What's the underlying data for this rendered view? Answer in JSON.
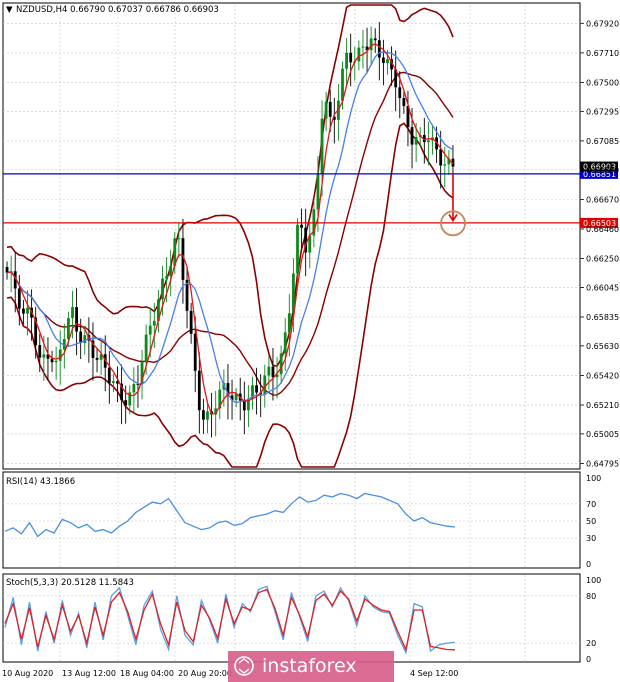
{
  "chart_data": [
    {
      "type": "candlestick",
      "title": "NZDUSD,H4  0.66790 0.67037 0.66786 0.66903",
      "symbol_marker": "▼",
      "ylim": [
        0.6477,
        0.6805
      ],
      "y_ticks": [
        0.6792,
        0.6771,
        0.675,
        0.67295,
        0.67085,
        0.6688,
        0.6667,
        0.6646,
        0.6625,
        0.66045,
        0.65835,
        0.6563,
        0.6542,
        0.6521,
        0.65005,
        0.64795
      ],
      "y_tick_labels": [
        "0.67920",
        "0.67710",
        "0.67500",
        "0.67295",
        "0.67085",
        "0.66880",
        "0.66670",
        "0.66460",
        "0.66250",
        "0.66045",
        "0.65835",
        "0.65630",
        "0.65420",
        "0.65210",
        "0.65005",
        "0.64795"
      ],
      "price_levels": [
        {
          "value": 0.66851,
          "label": "0.66851",
          "color": "#0000cc"
        },
        {
          "value": 0.66503,
          "label": "0.66503",
          "color": "#e00000"
        }
      ],
      "current_price": {
        "value": 0.66903,
        "label": "0.66903"
      },
      "close_path": [
        0.6615,
        0.6602,
        0.6581,
        0.659,
        0.6553,
        0.656,
        0.6542,
        0.657,
        0.6589,
        0.6573,
        0.6565,
        0.6552,
        0.6546,
        0.654,
        0.6531,
        0.6525,
        0.6533,
        0.656,
        0.6585,
        0.6606,
        0.6621,
        0.664,
        0.6598,
        0.6554,
        0.6515,
        0.6512,
        0.6525,
        0.653,
        0.6528,
        0.6524,
        0.653,
        0.6527,
        0.654,
        0.6545,
        0.656,
        0.66,
        0.665,
        0.6628,
        0.666,
        0.6745,
        0.672,
        0.674,
        0.677,
        0.6765,
        0.6782,
        0.678,
        0.6768,
        0.6758,
        0.6752,
        0.673,
        0.6712,
        0.6705,
        0.671,
        0.67,
        0.6697,
        0.669
      ],
      "annotations": [
        {
          "type": "arrow",
          "from": 0.6685,
          "to": 0.6652,
          "color": "#e00000"
        },
        {
          "type": "circle",
          "at": 0.665,
          "color": "#c8845a"
        }
      ]
    },
    {
      "type": "line",
      "title": "RSI(14) 43.1866",
      "ylim": [
        0,
        100
      ],
      "y_ticks": [
        100,
        70,
        50,
        30,
        0
      ],
      "y_tick_labels": [
        "100",
        "70",
        "50",
        "30",
        "0"
      ],
      "values": [
        38,
        42,
        35,
        48,
        32,
        40,
        36,
        52,
        48,
        42,
        46,
        38,
        40,
        36,
        44,
        50,
        60,
        66,
        72,
        70,
        76,
        62,
        48,
        44,
        40,
        42,
        48,
        50,
        45,
        47,
        54,
        56,
        58,
        62,
        60,
        70,
        78,
        72,
        74,
        80,
        78,
        82,
        80,
        76,
        82,
        80,
        78,
        74,
        70,
        58,
        50,
        54,
        48,
        46,
        44,
        43
      ]
    },
    {
      "type": "line",
      "title": "Stoch(5,3,3) 20.5128 11.5843",
      "ylim": [
        0,
        100
      ],
      "y_ticks": [
        100,
        80,
        20,
        0
      ],
      "y_tick_labels": [
        "100",
        "80",
        "20",
        "0"
      ],
      "series": [
        {
          "color": "#5ba0e6",
          "values": [
            40,
            78,
            18,
            72,
            10,
            60,
            20,
            74,
            30,
            58,
            14,
            72,
            24,
            80,
            90,
            55,
            18,
            68,
            86,
            38,
            12,
            80,
            30,
            18,
            74,
            50,
            20,
            82,
            40,
            70,
            60,
            88,
            92,
            60,
            24,
            84,
            54,
            22,
            80,
            86,
            66,
            90,
            74,
            42,
            80,
            66,
            60,
            58,
            30,
            8,
            70,
            66,
            10,
            18,
            20,
            21
          ]
        },
        {
          "color": "#e02020",
          "values": [
            45,
            70,
            25,
            65,
            15,
            55,
            25,
            68,
            35,
            55,
            20,
            66,
            30,
            72,
            84,
            60,
            25,
            62,
            82,
            45,
            18,
            72,
            36,
            22,
            68,
            52,
            26,
            76,
            45,
            66,
            62,
            84,
            88,
            64,
            30,
            78,
            56,
            28,
            74,
            82,
            68,
            86,
            76,
            48,
            76,
            68,
            62,
            60,
            35,
            12,
            62,
            62,
            16,
            14,
            12,
            11.6
          ]
        }
      ]
    }
  ],
  "x_labels": [
    "10 Aug 2020",
    "13 Aug 12:00",
    "18 Aug 04:00",
    "20 Aug 20:00",
    "4 Sep 12:00"
  ],
  "watermark": "instaforex",
  "colors": {
    "bull": "#0c8a1c",
    "bear": "#000000",
    "bollinger": "#8b0000",
    "ma_fast": "#e01818",
    "ma_slow": "#4a7fe8",
    "rsi": "#4a90e2"
  }
}
